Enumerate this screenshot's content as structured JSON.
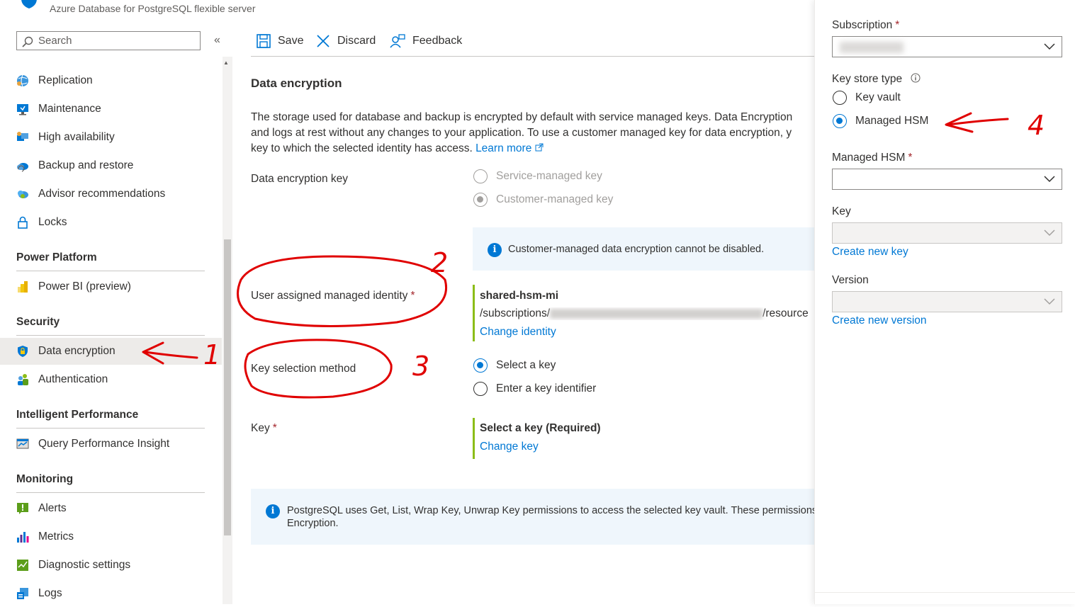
{
  "header": {
    "subtitle": "Azure Database for PostgreSQL flexible server"
  },
  "sidebar": {
    "search_placeholder": "Search",
    "collapse_glyph": "«",
    "items_top": [
      {
        "label": "Replication",
        "icon": "replication-globe-icon"
      },
      {
        "label": "Maintenance",
        "icon": "maintenance-monitor-icon"
      },
      {
        "label": "High availability",
        "icon": "high-availability-icon"
      },
      {
        "label": "Backup and restore",
        "icon": "backup-cloud-icon"
      },
      {
        "label": "Advisor recommendations",
        "icon": "advisor-cloud-icon"
      },
      {
        "label": "Locks",
        "icon": "lock-icon"
      }
    ],
    "power_platform": {
      "heading": "Power Platform",
      "items": [
        {
          "label": "Power BI (preview)",
          "icon": "power-bi-icon"
        }
      ]
    },
    "security": {
      "heading": "Security",
      "items": [
        {
          "label": "Data encryption",
          "icon": "shield-icon",
          "active": true
        },
        {
          "label": "Authentication",
          "icon": "users-icon"
        }
      ]
    },
    "intelligent_performance": {
      "heading": "Intelligent Performance",
      "items": [
        {
          "label": "Query Performance Insight",
          "icon": "query-insight-icon"
        }
      ]
    },
    "monitoring": {
      "heading": "Monitoring",
      "items": [
        {
          "label": "Alerts",
          "icon": "alert-icon"
        },
        {
          "label": "Metrics",
          "icon": "metrics-bar-icon"
        },
        {
          "label": "Diagnostic settings",
          "icon": "diagnostic-icon"
        },
        {
          "label": "Logs",
          "icon": "logs-icon"
        }
      ]
    }
  },
  "toolbar": {
    "save_label": "Save",
    "discard_label": "Discard",
    "feedback_label": "Feedback"
  },
  "main": {
    "title": "Data encryption",
    "description_lines": [
      "The storage used for database and backup is encrypted by default with service managed keys. Data Encryption",
      "and logs at rest without any changes to your application. To use a customer managed key for data encryption, y",
      "key to which the selected identity has access."
    ],
    "learn_more": "Learn more",
    "data_encryption_key": {
      "label": "Data encryption key",
      "options": [
        {
          "label": "Service-managed key",
          "selected": false
        },
        {
          "label": "Customer-managed key",
          "selected": true
        }
      ]
    },
    "info_banner": "Customer-managed data encryption cannot be disabled.",
    "identity": {
      "label": "User assigned managed identity",
      "required_mark": "*",
      "name": "shared-hsm-mi",
      "path_prefix": "/subscriptions/",
      "path_suffix": "/resource",
      "change_link": "Change identity"
    },
    "key_selection": {
      "label": "Key selection method",
      "options": [
        {
          "label": "Select a key",
          "selected": true
        },
        {
          "label": "Enter a key identifier",
          "selected": false
        }
      ]
    },
    "key": {
      "label": "Key",
      "required_mark": "*",
      "value": "Select a key (Required)",
      "change_link": "Change key"
    },
    "permissions_banner_lines": [
      "PostgreSQL uses Get, List, Wrap Key, Unwrap Key permissions to access the selected key vault. These permissions",
      "Encryption."
    ]
  },
  "panel": {
    "subscription_label": "Subscription",
    "required_mark": "*",
    "key_store_type_label": "Key store type",
    "key_store_options": [
      {
        "label": "Key vault",
        "selected": false
      },
      {
        "label": "Managed HSM",
        "selected": true
      }
    ],
    "managed_hsm_label": "Managed HSM",
    "key_label": "Key",
    "create_key_link": "Create new key",
    "version_label": "Version",
    "create_version_link": "Create new version"
  },
  "annotations": {
    "n1": "1",
    "n2": "2",
    "n3": "3",
    "n4": "4"
  },
  "colors": {
    "accent": "#0078d4",
    "required": "#a4262c",
    "annotation": "#e00000",
    "success_bar": "#8cbd18"
  }
}
